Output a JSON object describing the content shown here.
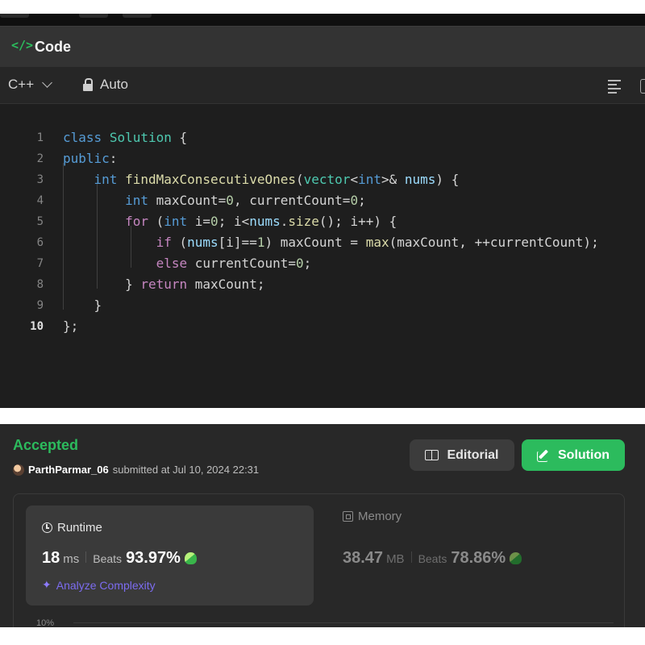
{
  "code_panel": {
    "icon_text": "</>",
    "title": "Code",
    "language": "C++",
    "mode": "Auto",
    "active_line": 10,
    "line_numbers": [
      "1",
      "2",
      "3",
      "4",
      "5",
      "6",
      "7",
      "8",
      "9",
      "10"
    ],
    "lines": [
      "class Solution {",
      "public:",
      "    int findMaxConsecutiveOnes(vector<int>& nums) {",
      "        int maxCount=0, currentCount=0;",
      "        for (int i=0; i<nums.size(); i++) {",
      "            if (nums[i]==1) maxCount = max(maxCount, ++currentCount);",
      "            else currentCount=0;",
      "        } return maxCount;",
      "    }",
      "};"
    ]
  },
  "result": {
    "status": "Accepted",
    "username": "ParthParmar_06",
    "submitted_text": "submitted at Jul 10, 2024 22:31",
    "editorial_label": "Editorial",
    "solution_label": "Solution",
    "runtime": {
      "label": "Runtime",
      "value": "18",
      "unit": "ms",
      "beats_label": "Beats",
      "beats_pct": "93.97%"
    },
    "memory": {
      "label": "Memory",
      "value": "38.47",
      "unit": "MB",
      "beats_label": "Beats",
      "beats_pct": "78.86%"
    },
    "analyze_label": "Analyze Complexity",
    "chart_tick": "10%"
  },
  "colors": {
    "accent_green": "#2cbb5d",
    "analyze_purple": "#7c6cf0",
    "background_dark": "#282828"
  }
}
